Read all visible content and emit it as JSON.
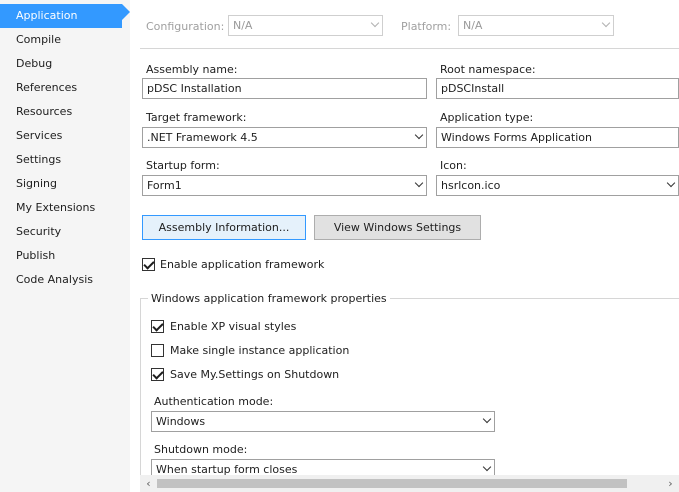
{
  "sidebar": {
    "items": [
      {
        "label": "Application",
        "active": true
      },
      {
        "label": "Compile"
      },
      {
        "label": "Debug"
      },
      {
        "label": "References"
      },
      {
        "label": "Resources"
      },
      {
        "label": "Services"
      },
      {
        "label": "Settings"
      },
      {
        "label": "Signing"
      },
      {
        "label": "My Extensions"
      },
      {
        "label": "Security"
      },
      {
        "label": "Publish"
      },
      {
        "label": "Code Analysis"
      }
    ]
  },
  "header": {
    "configuration_label": "Configuration:",
    "configuration_value": "N/A",
    "platform_label": "Platform:",
    "platform_value": "N/A"
  },
  "form": {
    "assembly_name_label": "Assembly name:",
    "assembly_name_value": "pDSC Installation",
    "root_namespace_label": "Root namespace:",
    "root_namespace_value": "pDSCInstall",
    "target_framework_label": "Target framework:",
    "target_framework_value": ".NET Framework 4.5",
    "application_type_label": "Application type:",
    "application_type_value": "Windows Forms Application",
    "startup_form_label": "Startup form:",
    "startup_form_value": "Form1",
    "icon_label": "Icon:",
    "icon_value": "hsrlcon.ico"
  },
  "buttons": {
    "assembly_info": "Assembly Information...",
    "view_windows_settings": "View Windows Settings"
  },
  "app_framework": {
    "enable_label": "Enable application framework",
    "enabled": true
  },
  "framework_props": {
    "group_title": "Windows application framework properties",
    "xp_styles_label": "Enable XP visual styles",
    "xp_styles_checked": true,
    "single_instance_label": "Make single instance application",
    "single_instance_checked": false,
    "save_settings_label": "Save My.Settings on Shutdown",
    "save_settings_checked": true,
    "auth_mode_label": "Authentication mode:",
    "auth_mode_value": "Windows",
    "shutdown_mode_label": "Shutdown mode:",
    "shutdown_mode_value": "When startup form closes"
  },
  "colors": {
    "accent": "#3399ff",
    "sidebar_bg": "#f5f5f5"
  }
}
